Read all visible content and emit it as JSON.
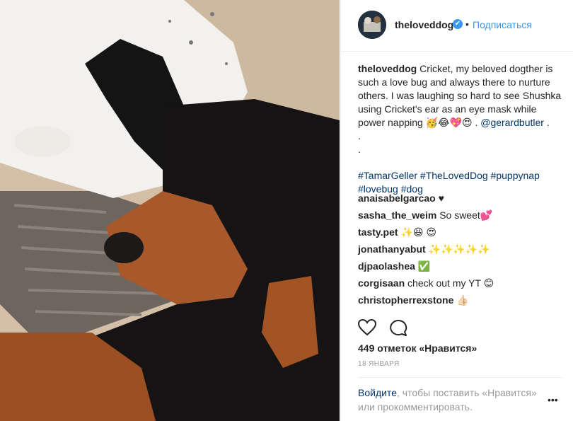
{
  "post": {
    "image_alt": "Two dogs sleeping on a pillow",
    "header": {
      "username": "theloveddog",
      "verified_glyph": "✔",
      "separator": "•",
      "follow_label": "Подписаться"
    },
    "caption": {
      "username": "theloveddog",
      "text": "Cricket, my beloved dogther is such a love bug and always there to nurture others. I was laughing so hard to see Shushka using Cricket's ear as an eye mask while power napping 🥳😂💖😍 .",
      "mention": "@gerardbutler",
      "after_mention": ".",
      "dot1": ".",
      "dot2": ".",
      "hashtags": "#TamarGeller #TheLovedDog #puppynap #lovebug #dog"
    },
    "comments": [
      {
        "user": "anaisabelgarcao",
        "text": "♥"
      },
      {
        "user": "sasha_the_weim",
        "text": "So sweet💕"
      },
      {
        "user": "tasty.pet",
        "text": "✨😆 😍"
      },
      {
        "user": "jonathanyabut",
        "text": "✨✨✨✨✨"
      },
      {
        "user": "djpaolashea",
        "text": "✅"
      },
      {
        "user": "corgisaan",
        "text": "check out my YT 😊"
      },
      {
        "user": "christopherrexstone",
        "text": "👍🏻"
      }
    ],
    "likes": "449 отметок «Нравится»",
    "date": "18 ЯНВАРЯ",
    "login_prompt": {
      "login_link": "Войдите",
      "rest": ", чтобы поставить «Нравится» или прокомментировать."
    },
    "more_glyph": "•••",
    "icons": [
      "heart-icon",
      "comment-icon",
      "verified-badge-icon",
      "more-options-icon"
    ],
    "colors": {
      "link": "#003569",
      "accent": "#3897f0",
      "muted": "#999999"
    }
  }
}
